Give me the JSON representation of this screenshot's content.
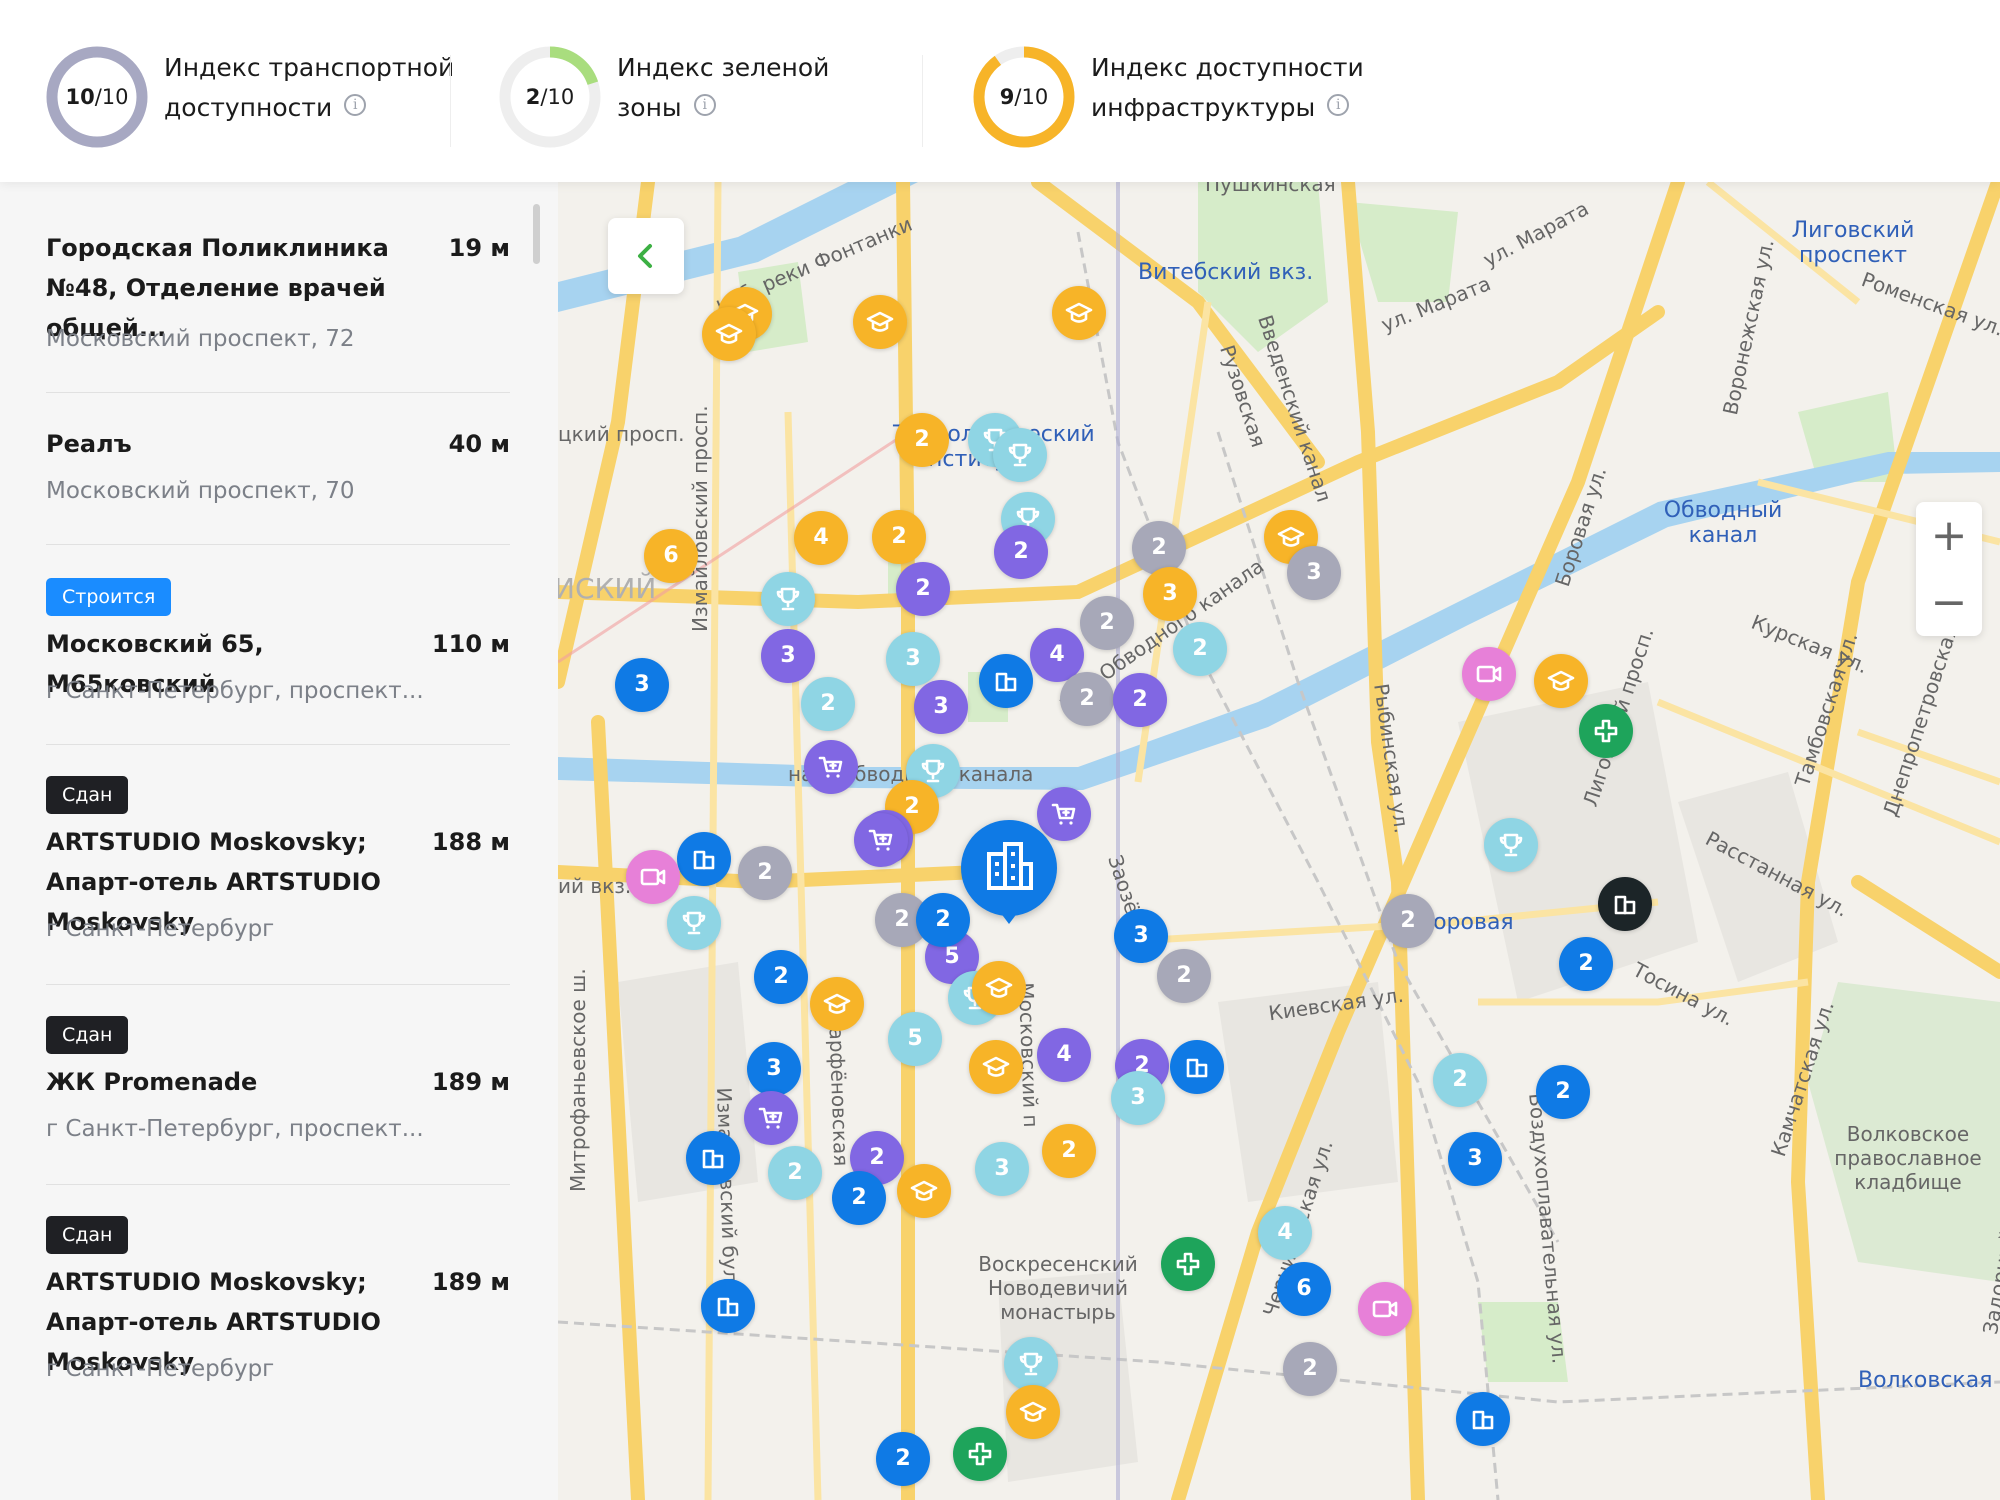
{
  "indices": [
    {
      "score": "10",
      "max": "/10",
      "label_line1": "Индекс транспортной",
      "label_line2": "доступности",
      "fraction": 1.0,
      "color": "#a7a8c2",
      "track": "#eeeeee"
    },
    {
      "score": "2",
      "max": "/10",
      "label_line1": "Индекс зеленой",
      "label_line2": "зоны",
      "fraction": 0.2,
      "color": "#a9dd7e",
      "track": "#eeeeee"
    },
    {
      "score": "9",
      "max": "/10",
      "label_line1": "Индекс доступности",
      "label_line2": "инфраструктуры",
      "fraction": 0.9,
      "color": "#f7b428",
      "track": "#eeeeee"
    }
  ],
  "info_icon": "info-icon",
  "list": [
    {
      "badge": "",
      "badge_color": "",
      "name": "Городская Поликлиника №48, Отделение врачей общей...",
      "distance": "19 м",
      "address": "Московский проспект, 72"
    },
    {
      "badge": "",
      "badge_color": "",
      "name": "Реалъ",
      "distance": "40 м",
      "address": "Московский проспект, 70"
    },
    {
      "badge": "Строится",
      "badge_color": "blue",
      "name": "Московский 65, М65ковский",
      "distance": "110 м",
      "address": "г Санкт-Петербург, проспект..."
    },
    {
      "badge": "Сдан",
      "badge_color": "dark",
      "name": "ARTSTUDIO Moskovsky; Апарт-отель ARTSTUDIO Moskovsky",
      "distance": "188 м",
      "address": "г Санкт-Петербург"
    },
    {
      "badge": "Сдан",
      "badge_color": "dark",
      "name": "ЖК Promenade",
      "distance": "189 м",
      "address": "г Санкт-Петербург, проспект..."
    },
    {
      "badge": "Сдан",
      "badge_color": "dark",
      "name": "ARTSTUDIO Moskovsky; Апарт-отель ARTSTUDIO Moskovsky",
      "distance": "189 м",
      "address": "г Санкт-Петербург"
    }
  ],
  "map": {
    "back_icon": "chevron-left-icon",
    "zoom_in": "+",
    "zoom_out": "−",
    "labels": {
      "pushkinskaya": "Пушкинская",
      "vitebsky": "Витебский вкз.",
      "ligovsky": "Лиговский проспект",
      "tekhnolog": "Технологический институт-1",
      "obvodny": "Обводный канал",
      "borovaya": "Боровая",
      "volkovskaya": "Волковская",
      "fontanka": "наб. реки Фонтанки",
      "marata1": "ул. Марата",
      "marata2": "ул. Марата",
      "obvodnogo1": "наб. Обводного канала",
      "obvodnogo2": "наб. Обводного канала",
      "izmailovsky": "Измайловский просп.",
      "voskresensky": "Воскресенский Новодевичий монастырь",
      "volkovskoe": "Волковское православное кладбище",
      "kievskaya": "Киевская ул.",
      "rasstannaya": "Расстанная ул.",
      "kurskaya": "Курская ул.",
      "romenskaya": "Роменская ул.",
      "mitrofanievskoe": "Митрофаньевское ш.",
      "vozdukhoplav": "Воздухоплавательная ул.",
      "rybinskaya": "Рыбинская ул.",
      "ligovsky_pr": "Лиговский просп.",
      "ruzovskaya": "Рузовская",
      "vvedensky": "Введенский канал",
      "district": "ИСКИЙ",
      "sad": "цкий просп.",
      "vkz": "ий вкз.",
      "izm_bulv": "Измайловский бульв.",
      "pafn": "Парфёновская",
      "zaoz": "Заозёрная",
      "moskovsky": "Московский п",
      "tosina": "Тосина ул.",
      "kamchatskaya": "Камчатская ул.",
      "dnepr": "Днепропетровская",
      "tambov": "Тамбовская ул.",
      "voronezh": "Воронежская ул.",
      "borovaya_ul": "Боровая ул.",
      "chernigov": "Черниговская ул.",
      "zadorny": "Задорный ул."
    },
    "markers": [
      {
        "color": "orange",
        "text": "",
        "icon": "graduation-icon"
      },
      {
        "color": "orange",
        "text": "",
        "icon": "graduation-icon"
      },
      {
        "color": "orange",
        "text": "",
        "icon": "graduation-icon"
      },
      {
        "color": "orange",
        "text": "",
        "icon": "graduation-icon"
      },
      {
        "color": "orange",
        "text": "2",
        "icon": ""
      },
      {
        "color": "light",
        "text": "",
        "icon": "trophy-icon"
      },
      {
        "color": "light",
        "text": "",
        "icon": "trophy-icon"
      },
      {
        "color": "light",
        "text": "",
        "icon": "trophy-icon"
      },
      {
        "color": "orange",
        "text": "",
        "icon": "graduation-icon"
      },
      {
        "color": "gray",
        "text": "3",
        "icon": ""
      },
      {
        "color": "orange",
        "text": "6",
        "icon": ""
      },
      {
        "color": "orange",
        "text": "4",
        "icon": ""
      },
      {
        "color": "orange",
        "text": "2",
        "icon": ""
      },
      {
        "color": "purple",
        "text": "2",
        "icon": ""
      },
      {
        "color": "gray",
        "text": "2",
        "icon": ""
      },
      {
        "color": "purple",
        "text": "2",
        "icon": ""
      },
      {
        "color": "orange",
        "text": "3",
        "icon": ""
      },
      {
        "color": "gray",
        "text": "2",
        "icon": ""
      },
      {
        "color": "light",
        "text": "2",
        "icon": ""
      },
      {
        "color": "light",
        "text": "",
        "icon": "trophy-icon"
      },
      {
        "color": "purple",
        "text": "3",
        "icon": ""
      },
      {
        "color": "light",
        "text": "3",
        "icon": ""
      },
      {
        "color": "purple",
        "text": "4",
        "icon": ""
      },
      {
        "color": "blue",
        "text": "",
        "icon": "building-icon"
      },
      {
        "color": "blue",
        "text": "3",
        "icon": ""
      },
      {
        "color": "light",
        "text": "2",
        "icon": ""
      },
      {
        "color": "purple",
        "text": "3",
        "icon": ""
      },
      {
        "color": "gray",
        "text": "2",
        "icon": ""
      },
      {
        "color": "purple",
        "text": "2",
        "icon": ""
      },
      {
        "color": "purple",
        "text": "",
        "icon": "cart-icon"
      },
      {
        "color": "light",
        "text": "",
        "icon": "trophy-icon"
      },
      {
        "color": "orange",
        "text": "2",
        "icon": ""
      },
      {
        "color": "purple",
        "text": "",
        "icon": "cart-icon"
      },
      {
        "color": "purple",
        "text": "2",
        "icon": ""
      },
      {
        "color": "purple",
        "text": "",
        "icon": "cart-icon"
      },
      {
        "color": "blue",
        "text": "",
        "icon": "building-icon"
      },
      {
        "color": "gray",
        "text": "2",
        "icon": ""
      },
      {
        "color": "pink",
        "text": "",
        "icon": "video-icon"
      },
      {
        "color": "light",
        "text": "",
        "icon": "trophy-icon"
      },
      {
        "color": "gray",
        "text": "2",
        "icon": ""
      },
      {
        "color": "blue",
        "text": "2",
        "icon": ""
      },
      {
        "color": "purple",
        "text": "5",
        "icon": ""
      },
      {
        "color": "gray",
        "text": "2",
        "icon": ""
      },
      {
        "color": "blue",
        "text": "3",
        "icon": ""
      },
      {
        "color": "gray",
        "text": "2",
        "icon": ""
      },
      {
        "color": "blue",
        "text": "2",
        "icon": ""
      },
      {
        "color": "orange",
        "text": "",
        "icon": "graduation-icon"
      },
      {
        "color": "light",
        "text": "",
        "icon": "trophy-icon"
      },
      {
        "color": "orange",
        "text": "",
        "icon": "graduation-icon"
      },
      {
        "color": "light",
        "text": "5",
        "icon": ""
      },
      {
        "color": "orange",
        "text": "",
        "icon": "graduation-icon"
      },
      {
        "color": "purple",
        "text": "4",
        "icon": ""
      },
      {
        "color": "purple",
        "text": "2",
        "icon": ""
      },
      {
        "color": "blue",
        "text": "",
        "icon": "building-icon"
      },
      {
        "color": "light",
        "text": "3",
        "icon": ""
      },
      {
        "color": "blue",
        "text": "3",
        "icon": ""
      },
      {
        "color": "purple",
        "text": "",
        "icon": "cart-icon"
      },
      {
        "color": "blue",
        "text": "",
        "icon": "building-icon"
      },
      {
        "color": "light",
        "text": "2",
        "icon": ""
      },
      {
        "color": "purple",
        "text": "2",
        "icon": ""
      },
      {
        "color": "orange",
        "text": "",
        "icon": "graduation-icon"
      },
      {
        "color": "blue",
        "text": "2",
        "icon": ""
      },
      {
        "color": "light",
        "text": "3",
        "icon": ""
      },
      {
        "color": "orange",
        "text": "2",
        "icon": ""
      },
      {
        "color": "blue",
        "text": "",
        "icon": "building-icon"
      },
      {
        "color": "light",
        "text": "",
        "icon": "trophy-icon"
      },
      {
        "color": "orange",
        "text": "",
        "icon": "graduation-icon"
      },
      {
        "color": "blue",
        "text": "2",
        "icon": ""
      },
      {
        "color": "green",
        "text": "",
        "icon": "medical-cross-icon"
      },
      {
        "color": "light",
        "text": "4",
        "icon": ""
      },
      {
        "color": "pink",
        "text": "",
        "icon": "video-icon"
      },
      {
        "color": "blue",
        "text": "6",
        "icon": ""
      },
      {
        "color": "gray",
        "text": "2",
        "icon": ""
      },
      {
        "color": "light",
        "text": "2",
        "icon": ""
      },
      {
        "color": "blue",
        "text": "2",
        "icon": ""
      },
      {
        "color": "light",
        "text": "",
        "icon": "trophy-icon"
      },
      {
        "color": "dark",
        "text": "",
        "icon": "building-icon"
      },
      {
        "color": "blue",
        "text": "2",
        "icon": ""
      },
      {
        "color": "orange",
        "text": "",
        "icon": "graduation-icon"
      },
      {
        "color": "green",
        "text": "",
        "icon": "medical-cross-icon"
      },
      {
        "color": "pink",
        "text": "",
        "icon": "video-icon"
      },
      {
        "color": "blue",
        "text": "",
        "icon": "building-icon"
      },
      {
        "color": "blue",
        "text": "3",
        "icon": ""
      },
      {
        "color": "green",
        "text": "",
        "icon": "medical-cross-icon"
      }
    ],
    "main_pin_icon": "building-icon"
  }
}
